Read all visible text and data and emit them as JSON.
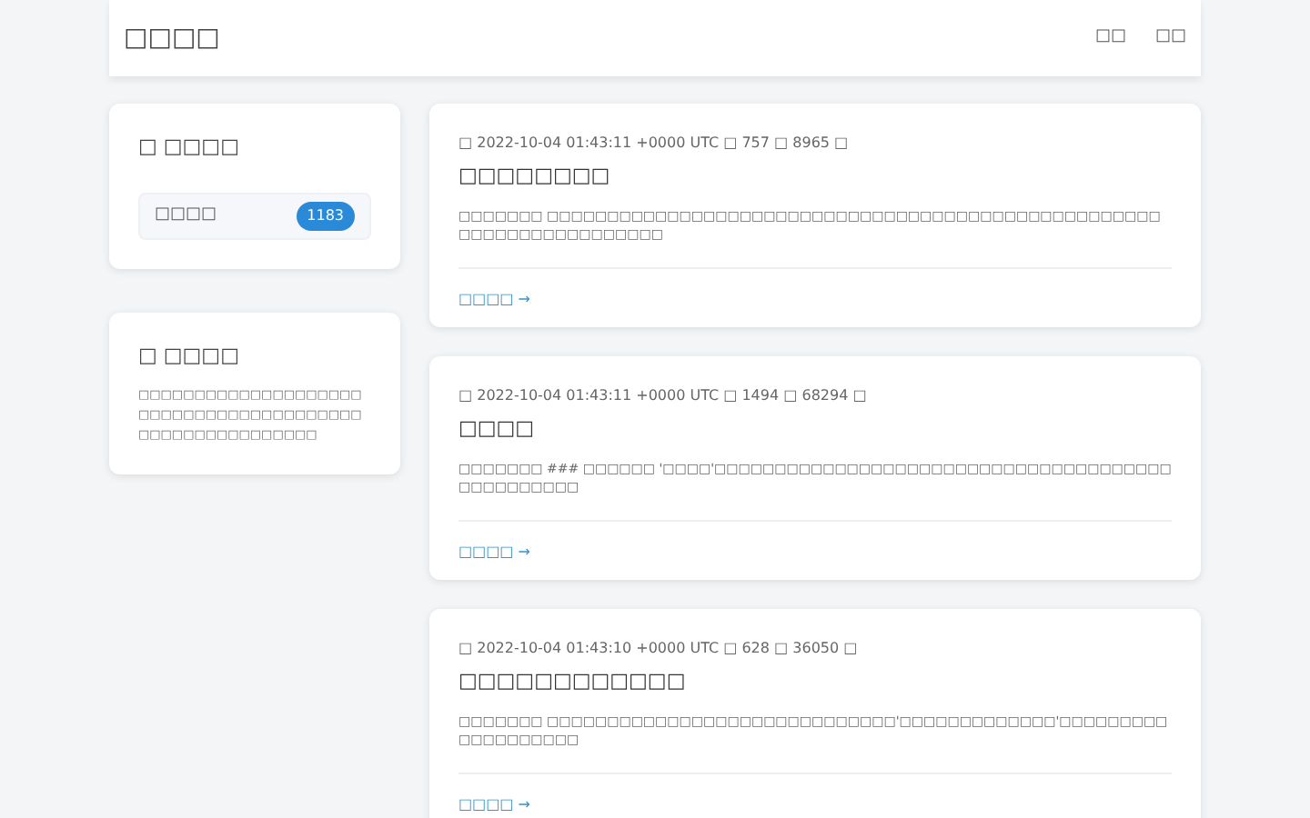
{
  "navbar": {
    "brand": "□□□□",
    "links": [
      "□□",
      "□□"
    ]
  },
  "sidebar": {
    "categories": {
      "title": "□ □□□□",
      "items": [
        {
          "label": "□□□□",
          "count": "1183"
        }
      ]
    },
    "about": {
      "title": "□ □□□□",
      "text": "□□□□□□□□□□□□□□□□□□□□□□□□□□□□□□□□□□□□□□□□□□□□□□□□□□□□□□□□"
    }
  },
  "posts": [
    {
      "kind": "post",
      "meta": "□ 2022-10-04 01:43:11 +0000 UTC  □ 757  □ 8965 □",
      "title": "□□□□□□□□",
      "excerpt": "□□□□□□□ □□□□□□□□□□□□□□□□□□□□□□□□□□□□□□□□□□□□□□□□□□□□□□□□□□□□□□□□□□□□□□□□□□□□",
      "read_more": "□□□□ →"
    },
    {
      "kind": "post",
      "meta": "□ 2022-10-04 01:43:11 +0000 UTC  □ 1494  □ 68294 □",
      "title": "□□□□",
      "excerpt": "□□□□□□□ ### □□□□□□ '□□□□'□□□□□□□□□□□□□□□□□□□□□□□□□□□□□□□□□□□□□□□□□□□□□□□□",
      "read_more": "□□□□ →"
    },
    {
      "kind": "post",
      "meta": "□ 2022-10-04 01:43:10 +0000 UTC  □ 628  □ 36050 □",
      "title": "□□□□□□□□□□□□",
      "excerpt": "□□□□□□□ □□□□□□□□□□□□□□□□□□□□□□□□□□□□□'□□□□□□□□□□□□□'□□□□□□□□□□□□□□□□□□□",
      "read_more": "□□□□ →"
    }
  ]
}
